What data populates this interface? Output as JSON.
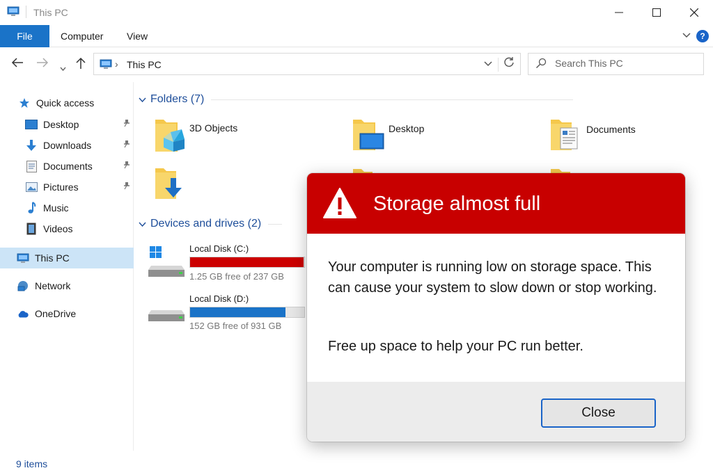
{
  "window": {
    "title": "This PC",
    "minimize_icon": "minimize-icon",
    "maximize_icon": "maximize-icon",
    "close_icon": "close-icon"
  },
  "ribbon": {
    "tabs": [
      {
        "label": "File",
        "active": true
      },
      {
        "label": "Computer"
      },
      {
        "label": "View"
      }
    ],
    "help_label": "?"
  },
  "address": {
    "crumb": "This PC",
    "separator": "›"
  },
  "search": {
    "placeholder": "Search This PC"
  },
  "sidebar": {
    "items": [
      {
        "label": "Quick access",
        "icon": "star-icon"
      },
      {
        "label": "Desktop",
        "icon": "desktop-icon",
        "pinned": true
      },
      {
        "label": "Downloads",
        "icon": "download-icon",
        "pinned": true
      },
      {
        "label": "Documents",
        "icon": "document-icon",
        "pinned": true
      },
      {
        "label": "Pictures",
        "icon": "picture-icon",
        "pinned": true
      },
      {
        "label": "Music",
        "icon": "music-icon"
      },
      {
        "label": "Videos",
        "icon": "video-icon"
      },
      {
        "label": "This PC",
        "icon": "computer-icon",
        "selected": true
      },
      {
        "label": "Network",
        "icon": "network-icon"
      },
      {
        "label": "OneDrive",
        "icon": "cloud-icon"
      }
    ]
  },
  "folders": {
    "header": "Folders (7)",
    "items": [
      {
        "label": "3D Objects"
      },
      {
        "label": "Desktop"
      },
      {
        "label": "Documents"
      }
    ]
  },
  "drives": {
    "header": "Devices and drives (2)",
    "items": [
      {
        "name": "Local Disk (C:)",
        "free": "1.25 GB free of 237 GB",
        "used_fraction": 0.995,
        "bar_color": "#cc0000"
      },
      {
        "name": "Local Disk (D:)",
        "free": "152 GB free of 931 GB",
        "used_fraction": 0.837,
        "bar_color": "#1a73c8"
      }
    ]
  },
  "status": {
    "item_count": "9 items"
  },
  "dialog": {
    "title": "Storage almost full",
    "message": "Your computer is running low on storage space. This can cause your system to slow down or stop working.",
    "message2": "Free up space to help your PC run better.",
    "close_label": "Close",
    "header_color": "#c80000"
  },
  "colors": {
    "accent": "#1a73c8",
    "danger": "#c80000",
    "selected": "#cce4f7"
  }
}
